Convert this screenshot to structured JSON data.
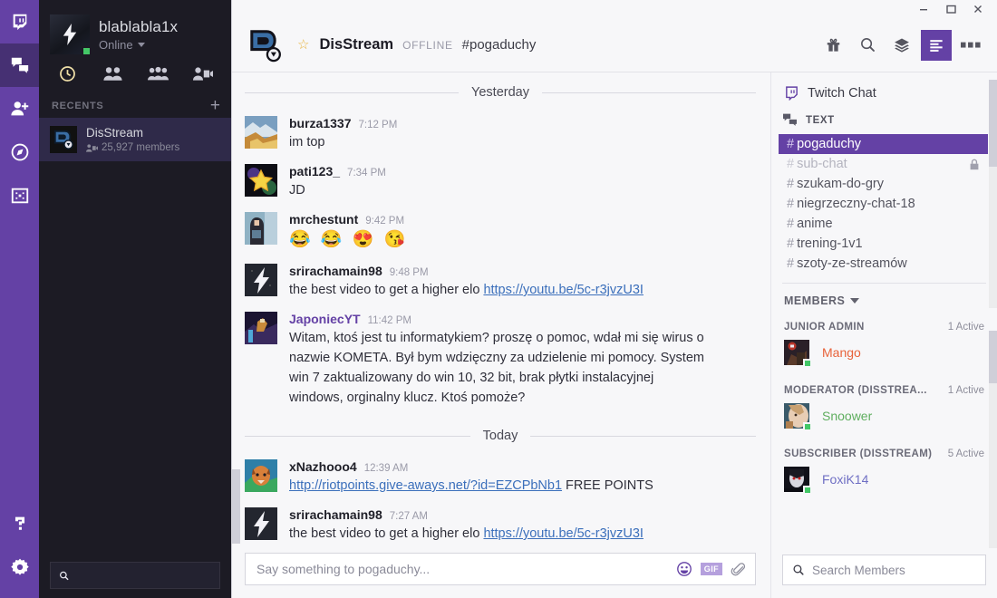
{
  "rail": {
    "items": [
      {
        "name": "twitch",
        "icon": "twitch-icon",
        "active": false
      },
      {
        "name": "messages",
        "icon": "chat-bubbles-icon",
        "active": true
      },
      {
        "name": "add-friend",
        "icon": "add-friend-icon",
        "active": false
      },
      {
        "name": "discover",
        "icon": "compass-icon",
        "active": false
      },
      {
        "name": "screenshare",
        "icon": "screenshare-icon",
        "active": false
      }
    ],
    "bottom_items": [
      {
        "name": "help",
        "icon": "question-mark-icon"
      },
      {
        "name": "settings",
        "icon": "gear-icon"
      }
    ],
    "accent": "#6441a5",
    "active_bg": "#463073"
  },
  "sidebar": {
    "user": {
      "name": "blablabla1x",
      "status": "Online",
      "status_color": "#44c767"
    },
    "nav_icons": [
      {
        "name": "recents-clock-icon",
        "active": true
      },
      {
        "name": "friends-icon",
        "active": false
      },
      {
        "name": "groups-icon",
        "active": false
      },
      {
        "name": "video-group-icon",
        "active": false
      }
    ],
    "recents_label": "RECENTS",
    "add_label": "+",
    "recents": [
      {
        "name": "DisStream",
        "members": "25,927 members",
        "active": true
      }
    ],
    "search_placeholder": ""
  },
  "window": {
    "minimize": "–",
    "maximize": "□",
    "close": "✕"
  },
  "topbar": {
    "star": "☆",
    "server": "DisStream",
    "offline": "OFFLINE",
    "channel": "#pogaduchy",
    "actions": [
      {
        "name": "gift-icon",
        "active": false
      },
      {
        "name": "search-icon",
        "active": false
      },
      {
        "name": "layers-icon",
        "active": false
      },
      {
        "name": "member-list-icon",
        "active": true
      },
      {
        "name": "more-options-icon",
        "active": false
      }
    ]
  },
  "chat": {
    "dividers": {
      "yesterday": "Yesterday",
      "today": "Today"
    },
    "messages_yesterday": [
      {
        "author": "burza1337",
        "time": "7:12 PM",
        "text": "im top",
        "avatar": "landscape-photo",
        "author_color": "#1f1f28"
      },
      {
        "author": "pati123_",
        "time": "7:34 PM",
        "text": "JD",
        "avatar": "star-photo",
        "author_color": "#1f1f28"
      },
      {
        "author": "mrchestunt",
        "time": "9:42 PM",
        "text": "😂 😂 😍 😘",
        "is_emoji": true,
        "avatar": "person-photo",
        "author_color": "#1f1f28"
      },
      {
        "author": "srirachamain98",
        "time": "9:48 PM",
        "text_before": "the best video to get a higher elo ",
        "link": "https://youtu.be/5c-r3jvzU3I",
        "avatar": "bolt-photo",
        "author_color": "#1f1f28"
      },
      {
        "author": "JaponiecYT",
        "time": "11:42 PM",
        "text": "Witam, ktoś jest tu informatykiem? proszę o pomoc, wdał mi się wirus o nazwie KOMETA. Był bym wdzięczny za udzielenie mi pomocy. System win 7 zaktualizowany do win 10, 32 bit, brak płytki instalacyjnej windows, orginalny klucz. Ktoś pomoże?",
        "avatar": "game-photo",
        "author_color": "#6441a5"
      }
    ],
    "messages_today": [
      {
        "author": "xNazhooo4",
        "time": "12:39 AM",
        "link": "http://riotpoints.give-aways.net/?id=EZCPbNb1",
        "text_after": "  FREE POINTS",
        "avatar": "dog-photo",
        "author_color": "#1f1f28"
      },
      {
        "author": "srirachamain98",
        "time": "7:27 AM",
        "text_before": "the best video to get a higher elo ",
        "link": "https://youtu.be/5c-r3jvzU3I",
        "avatar": "bolt-photo",
        "author_color": "#1f1f28"
      }
    ],
    "composer": {
      "placeholder": "Say something to pogaduchy...",
      "emoji_icon": "emoji-icon",
      "gif_label": "GIF",
      "attach_icon": "paperclip-icon"
    }
  },
  "right_panel": {
    "header": {
      "icon": "twitch-icon",
      "label": "Twitch Chat"
    },
    "text_section": {
      "icon": "chat-bubbles-icon",
      "label": "TEXT"
    },
    "channels": [
      {
        "name": "pogaduchy",
        "active": true,
        "locked": false
      },
      {
        "name": "sub-chat",
        "active": false,
        "locked": true
      },
      {
        "name": "szukam-do-gry",
        "active": false,
        "locked": false
      },
      {
        "name": "niegrzeczny-chat-18",
        "active": false,
        "locked": false
      },
      {
        "name": "anime",
        "active": false,
        "locked": false
      },
      {
        "name": "trening-1v1",
        "active": false,
        "locked": false
      },
      {
        "name": "szoty-ze-streamów",
        "active": false,
        "locked": false
      }
    ],
    "members_label": "MEMBERS",
    "groups": [
      {
        "title": "JUNIOR ADMIN",
        "count": "1 Active",
        "members": [
          {
            "name": "Mango",
            "color": "#e8623a",
            "status": "online",
            "avatar": "warrior-photo"
          }
        ]
      },
      {
        "title": "MODERATOR (DISSTREA...",
        "count": "1 Active",
        "members": [
          {
            "name": "Snoower",
            "color": "#5fae5f",
            "status": "online",
            "avatar": "face-photo"
          }
        ]
      },
      {
        "title": "SUBSCRIBER (DISSTREAM)",
        "count": "5 Active",
        "members": [
          {
            "name": "FoxiK14",
            "color": "#6f6fc4",
            "status": "online",
            "avatar": "dark-photo"
          }
        ]
      }
    ],
    "search_placeholder": "Search Members",
    "search_icon": "search-icon"
  }
}
